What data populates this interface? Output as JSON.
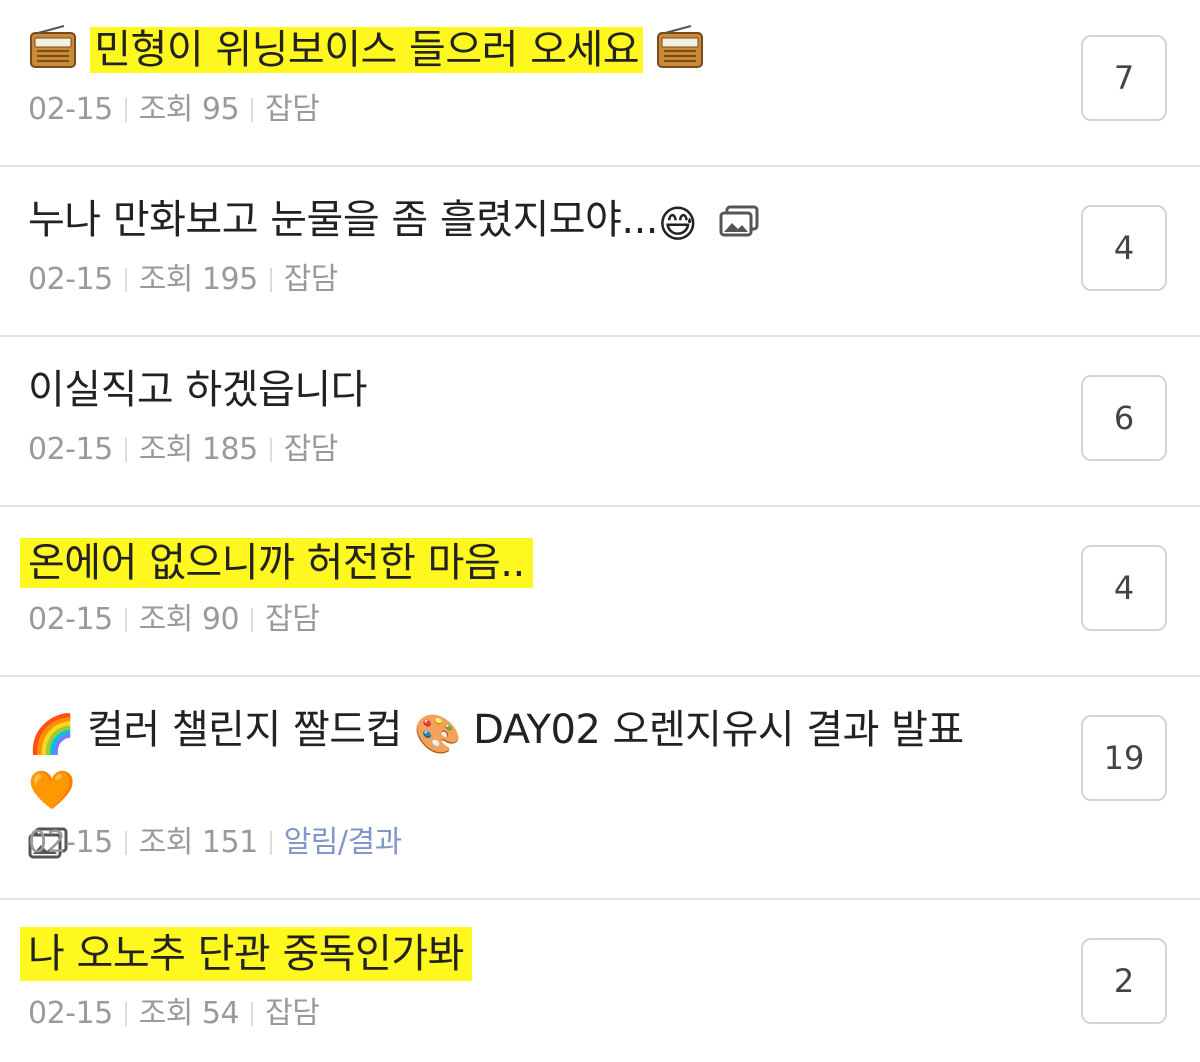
{
  "posts": [
    {
      "title": "민형이 위닝보이스 들으러 오세요",
      "date": "02-15",
      "views": "조회 95",
      "category": "잡담",
      "comments": "7",
      "leading_icon": "radio-icon",
      "trailing_icon": "radio-icon",
      "highlighted": true
    },
    {
      "title": "누나 만화보고 눈물을 좀 흘렸지모야...",
      "date": "02-15",
      "views": "조회 195",
      "category": "잡담",
      "comments": "4",
      "trailing_emoji": "😅",
      "trailing_icon": "image-attachment-icon",
      "highlighted": false
    },
    {
      "title": "이실직고 하겠읍니다",
      "date": "02-15",
      "views": "조회 185",
      "category": "잡담",
      "comments": "6",
      "highlighted": false
    },
    {
      "title": "온에어 없으니까 허전한 마음..",
      "date": "02-15",
      "views": "조회 90",
      "category": "잡담",
      "comments": "4",
      "highlighted": true
    },
    {
      "title_parts": [
        "컬러 챌린지 짤드컵",
        "DAY02 오렌지유시 결과 발표"
      ],
      "emoji_rainbow": "🌈",
      "emoji_palette": "🎨",
      "emoji_heart": "🧡",
      "date": "02-15",
      "views": "조회 151",
      "category": "알림/결과",
      "category_color": "#7f97c9",
      "comments": "19",
      "trailing_icon": "image-attachment-icon",
      "highlighted": false
    },
    {
      "title": "나 오노추 단관 중독인가봐",
      "date": "02-15",
      "views": "조회 54",
      "category": "잡담",
      "comments": "2",
      "highlighted": true
    }
  ],
  "colors": {
    "highlight": "#fff81f",
    "meta_text": "#9a9a9a",
    "divider": "#e3e3e3",
    "count_border": "#d4d4d4"
  }
}
